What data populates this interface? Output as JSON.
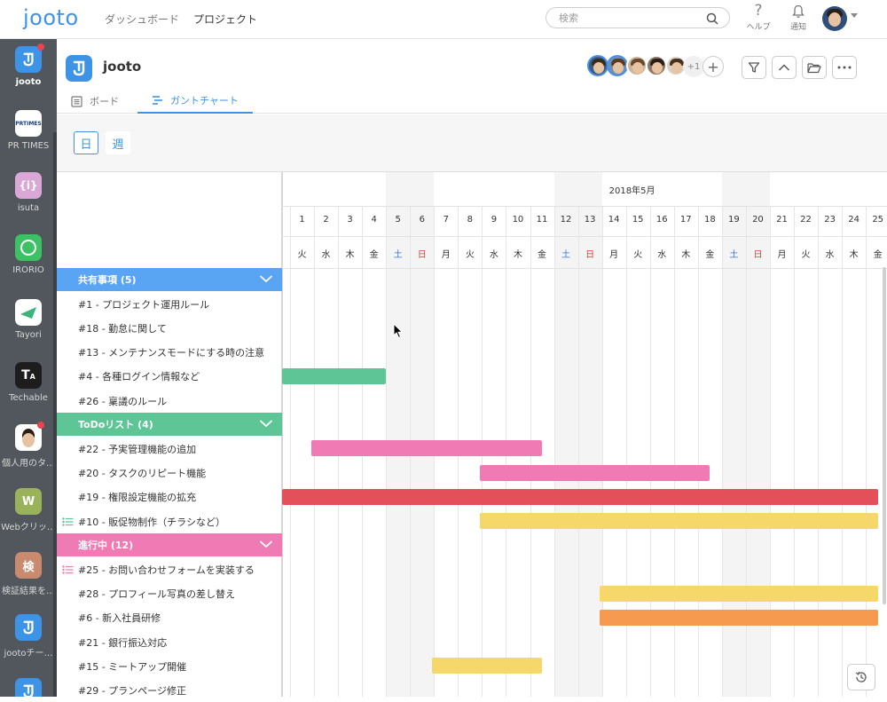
{
  "app": {
    "logo": "jooto"
  },
  "nav": {
    "dashboard": "ダッシュボード",
    "project": "プロジェクト"
  },
  "search": {
    "placeholder": "検索"
  },
  "topbar": {
    "help_label": "ヘルプ",
    "notify_label": "通知"
  },
  "sidebar": {
    "items": [
      {
        "label": "jooto",
        "icon": "jooto-logo-icon",
        "color": "#3d94e6",
        "active": true,
        "badge": true
      },
      {
        "label": "PR TIMES",
        "icon": "prtimes-logo-icon",
        "color": "#ffffff",
        "active": false,
        "badge": false
      },
      {
        "label": "isuta",
        "icon": "isuta-logo-icon",
        "color": "#d9a8d6",
        "active": false,
        "badge": false
      },
      {
        "label": "IRORIO",
        "icon": "irorio-logo-icon",
        "color": "#3cc265",
        "active": false,
        "badge": false
      },
      {
        "label": "Tayori",
        "icon": "tayori-logo-icon",
        "color": "#ffffff",
        "active": false,
        "badge": false
      },
      {
        "label": "Techable",
        "icon": "techable-logo-icon",
        "color": "#1d1d1d",
        "active": false,
        "badge": false
      },
      {
        "label": "個人用のタ…",
        "icon": "personal-avatar-icon",
        "color": "#ffffff",
        "active": false,
        "badge": true
      },
      {
        "label": "Webクリッ…",
        "icon": "letter-w-icon",
        "color": "#9ab25a",
        "active": false,
        "badge": false,
        "letter": "W"
      },
      {
        "label": "検証結果を…",
        "icon": "letter-kanji-icon",
        "color": "#c98a6e",
        "active": false,
        "badge": false,
        "letter": "検"
      },
      {
        "label": "jootoチー…",
        "icon": "jooto-logo-icon",
        "color": "#3d94e6",
        "active": false,
        "badge": false
      },
      {
        "label": "",
        "icon": "jooto-logo-icon",
        "color": "#3d94e6",
        "active": false,
        "badge": false
      }
    ]
  },
  "project": {
    "title": "jooto",
    "member_more": "+1",
    "tabs": [
      {
        "label": "ボード",
        "icon": "board-icon",
        "active": false
      },
      {
        "label": "ガントチャート",
        "icon": "gantt-icon",
        "active": true
      }
    ]
  },
  "view_toggle": {
    "day": "日",
    "week": "週",
    "selected": "day"
  },
  "gantt": {
    "month": "2018年5月",
    "first_partial_day": "0",
    "days": [
      {
        "d": "1",
        "w": "火"
      },
      {
        "d": "2",
        "w": "水"
      },
      {
        "d": "3",
        "w": "木"
      },
      {
        "d": "4",
        "w": "金"
      },
      {
        "d": "5",
        "w": "土"
      },
      {
        "d": "6",
        "w": "日"
      },
      {
        "d": "7",
        "w": "月"
      },
      {
        "d": "8",
        "w": "火"
      },
      {
        "d": "9",
        "w": "水"
      },
      {
        "d": "10",
        "w": "木"
      },
      {
        "d": "11",
        "w": "金"
      },
      {
        "d": "12",
        "w": "土"
      },
      {
        "d": "13",
        "w": "日"
      },
      {
        "d": "14",
        "w": "月"
      },
      {
        "d": "15",
        "w": "火"
      },
      {
        "d": "16",
        "w": "水"
      },
      {
        "d": "17",
        "w": "木"
      },
      {
        "d": "18",
        "w": "金"
      },
      {
        "d": "19",
        "w": "土"
      },
      {
        "d": "20",
        "w": "日"
      },
      {
        "d": "21",
        "w": "月"
      },
      {
        "d": "22",
        "w": "火"
      },
      {
        "d": "23",
        "w": "水"
      },
      {
        "d": "24",
        "w": "木"
      },
      {
        "d": "25",
        "w": "金"
      }
    ],
    "rows": [
      {
        "type": "group",
        "label": "共有事項 (5)",
        "color": "#5aa5f3"
      },
      {
        "type": "task",
        "label": "#1 - プロジェクト運用ルール"
      },
      {
        "type": "task",
        "label": "#18 - 勤怠に関して"
      },
      {
        "type": "task",
        "label": "#13 - メンテナンスモードにする時の注意"
      },
      {
        "type": "task",
        "label": "#4 - 各種ログイン情報など",
        "bar": {
          "start": 0.5,
          "end": 5.0,
          "color": "#5dc596"
        }
      },
      {
        "type": "task",
        "label": "#26 - 稟議のルール"
      },
      {
        "type": "group",
        "label": "ToDoリスト (4)",
        "color": "#5dc596"
      },
      {
        "type": "task",
        "label": "#22 - 予実管理機能の追加",
        "bar": {
          "start": 1.9,
          "end": 11.5,
          "color": "#f07bb4"
        }
      },
      {
        "type": "task",
        "label": "#20 - タスクのリピート機能",
        "bar": {
          "start": 8.9,
          "end": 18.5,
          "color": "#f07bb4"
        }
      },
      {
        "type": "task",
        "label": "#19 - 権限設定機能の拡充",
        "bar": {
          "start": 0.5,
          "end": 25.5,
          "color": "#e3505a"
        }
      },
      {
        "type": "task",
        "label": "#10 - 販促物制作（チラシなど）",
        "list_icon": true,
        "list_color": "#5dc596",
        "bar": {
          "start": 8.9,
          "end": 25.5,
          "color": "#f5d76a"
        }
      },
      {
        "type": "group",
        "label": "進行中 (12)",
        "color": "#f07bb4"
      },
      {
        "type": "task",
        "label": "#25 - お問い合わせフォームを実装する",
        "list_icon": true,
        "list_color": "#f07bb4"
      },
      {
        "type": "task",
        "label": "#28 - プロフィール写真の差し替え",
        "bar": {
          "start": 13.9,
          "end": 25.5,
          "color": "#f5d76a"
        }
      },
      {
        "type": "task",
        "label": "#6 - 新入社員研修",
        "bar": {
          "start": 13.9,
          "end": 25.5,
          "color": "#f59a4e"
        }
      },
      {
        "type": "task",
        "label": "#21 - 銀行振込対応"
      },
      {
        "type": "task",
        "label": "#15 - ミートアップ開催",
        "bar": {
          "start": 6.9,
          "end": 11.5,
          "color": "#f5d76a"
        }
      },
      {
        "type": "task",
        "label": "#29 - プランページ修正"
      }
    ]
  }
}
